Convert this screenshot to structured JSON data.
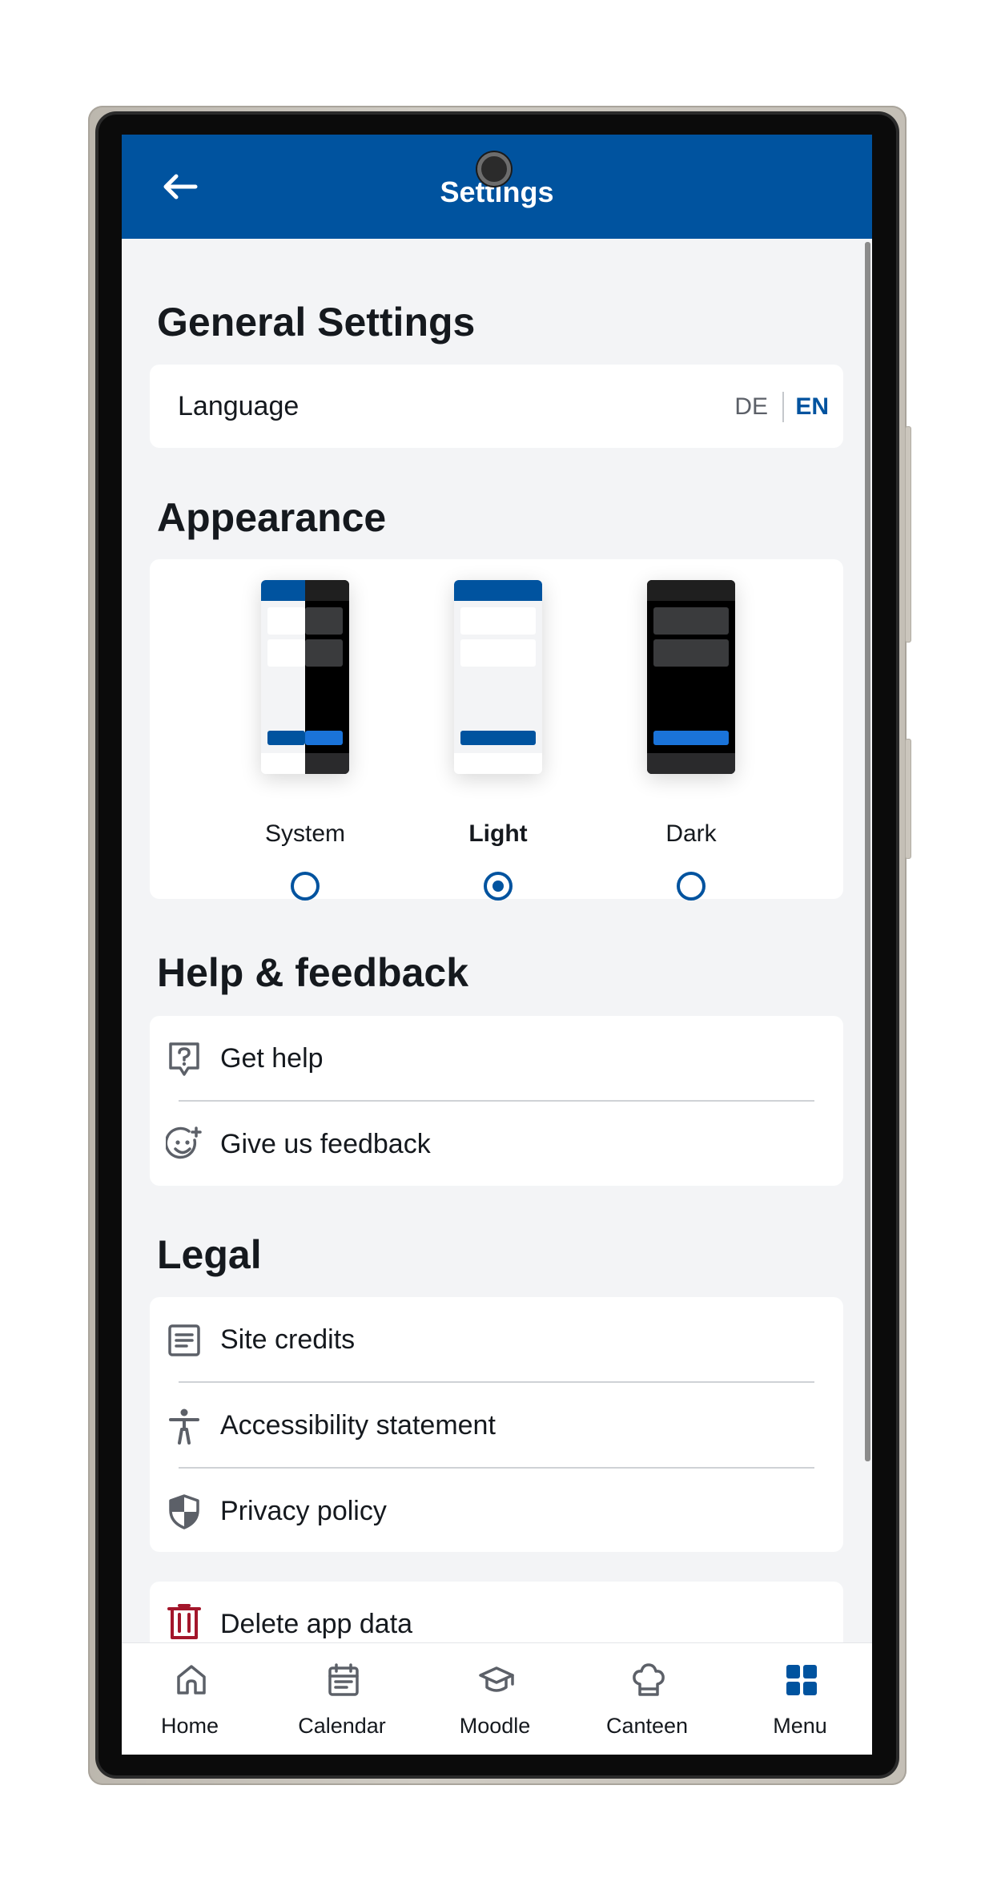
{
  "app": {
    "title": "Settings"
  },
  "colors": {
    "primary": "#00539f",
    "danger": "#a3162b",
    "background": "#f3f4f6",
    "card": "#ffffff",
    "text": "#15191e"
  },
  "general": {
    "title": "General Settings",
    "language_label": "Language",
    "languages": [
      "DE",
      "EN"
    ],
    "selected_language": "EN"
  },
  "appearance": {
    "title": "Appearance",
    "options": [
      {
        "label": "System",
        "selected": false
      },
      {
        "label": "Light",
        "selected": true
      },
      {
        "label": "Dark",
        "selected": false
      }
    ]
  },
  "help": {
    "title": "Help & feedback",
    "items": [
      {
        "label": "Get help",
        "icon": "help-icon"
      },
      {
        "label": "Give us feedback",
        "icon": "feedback-icon"
      }
    ]
  },
  "legal": {
    "title": "Legal",
    "items": [
      {
        "label": "Site credits",
        "icon": "document-icon"
      },
      {
        "label": "Accessibility statement",
        "icon": "accessibility-icon"
      },
      {
        "label": "Privacy policy",
        "icon": "shield-icon"
      }
    ]
  },
  "danger": {
    "delete_label": "Delete app data",
    "icon": "trash-icon"
  },
  "bottom_nav": {
    "items": [
      {
        "label": "Home",
        "icon": "home-icon",
        "active": false
      },
      {
        "label": "Calendar",
        "icon": "calendar-icon",
        "active": false
      },
      {
        "label": "Moodle",
        "icon": "graduation-cap-icon",
        "active": false
      },
      {
        "label": "Canteen",
        "icon": "chef-hat-icon",
        "active": false
      },
      {
        "label": "Menu",
        "icon": "grid-icon",
        "active": true
      }
    ]
  }
}
